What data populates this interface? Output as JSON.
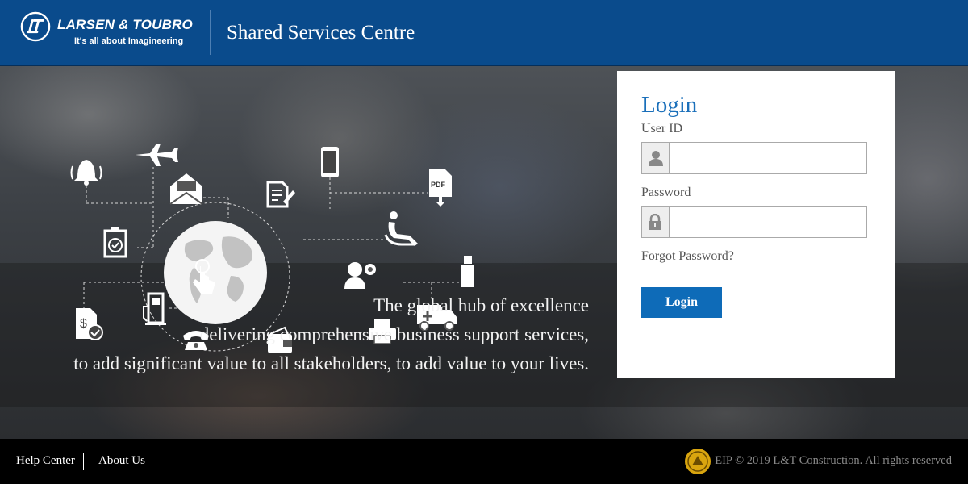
{
  "header": {
    "brand_name": "LARSEN & TOUBRO",
    "brand_tagline": "It's all about Imagineering",
    "site_title": "Shared Services Centre"
  },
  "hero": {
    "tagline_lines": [
      "The global hub of excellence",
      "delivering comprehensive business support services,",
      "to add significant value to all stakeholders, to add value to your lives."
    ],
    "pdf_label": "PDF",
    "service_icons": [
      "bell-icon",
      "airplane-icon",
      "mobile-phone-icon",
      "pdf-download-icon",
      "mail-icon",
      "document-edit-icon",
      "checklist-icon",
      "globe-icon",
      "recliner-icon",
      "touch-icon",
      "support-agent-icon",
      "usb-drive-icon",
      "fuel-pump-icon",
      "ambulance-icon",
      "invoice-check-icon",
      "telephone-icon",
      "wallet-icon",
      "printer-icon"
    ]
  },
  "login": {
    "title": "Login",
    "user_id_label": "User ID",
    "user_id_value": "",
    "password_label": "Password",
    "password_value": "",
    "forgot_password": "Forgot Password?",
    "button_label": "Login",
    "accent_color": "#1a6fba"
  },
  "footer": {
    "links": [
      "Help Center",
      "About Us"
    ],
    "copyright": "EIP © 2019 L&T Construction. All rights reserved"
  },
  "colors": {
    "header_bg": "#0a4b8c",
    "button_bg": "#0e6bb8",
    "footer_bg": "#000000"
  }
}
